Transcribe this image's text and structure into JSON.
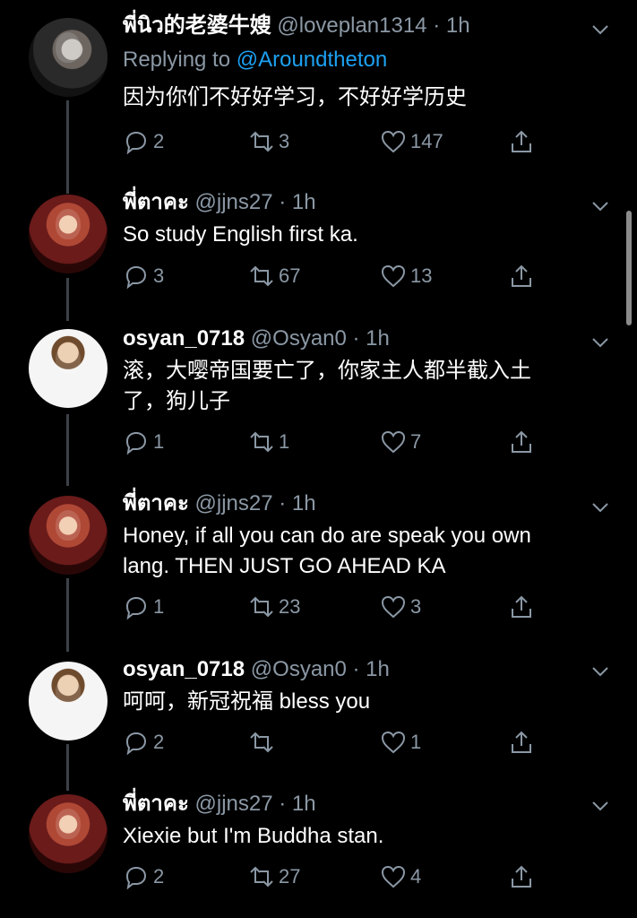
{
  "tweets": [
    {
      "name": "พี่นิว的老婆牛嫂",
      "handle": "@loveplan1314 · 1h",
      "replying_label": "Replying to ",
      "replying_to": "@Aroundtheton",
      "text_lines": [
        "因为你们不好好学习，不好好学历史"
      ],
      "replies": "2",
      "retweets": "3",
      "likes": "147"
    },
    {
      "name": "พี่ตาคะ",
      "handle": "@jjns27 · 1h",
      "text_lines": [
        "So study English first ka."
      ],
      "replies": "3",
      "retweets": "67",
      "likes": "13"
    },
    {
      "name": "osyan_0718",
      "handle": "@Osyan0 · 1h",
      "text_lines": [
        "滚，大嘤帝国要亡了，你家主人都半截入土",
        "了，狗儿子"
      ],
      "replies": "1",
      "retweets": "1",
      "likes": "7"
    },
    {
      "name": "พี่ตาคะ",
      "handle": "@jjns27 · 1h",
      "text_lines": [
        "Honey, if all you can do are speak you own",
        "lang. THEN JUST GO AHEAD KA"
      ],
      "replies": "1",
      "retweets": "23",
      "likes": "3"
    },
    {
      "name": "osyan_0718",
      "handle": "@Osyan0 · 1h",
      "text_lines": [
        "呵呵，新冠祝福 bless you"
      ],
      "replies": "2",
      "retweets": "",
      "likes": "1"
    },
    {
      "name": "พี่ตาคะ",
      "handle": "@jjns27 · 1h",
      "text_lines": [
        "Xiexie but I'm Buddha stan."
      ],
      "replies": "2",
      "retweets": "27",
      "likes": "4"
    }
  ],
  "icons": {
    "reply": "reply-icon",
    "retweet": "retweet-icon",
    "like": "like-icon",
    "share": "share-icon",
    "more": "chevron-down-icon"
  },
  "colors": {
    "background": "#000000",
    "muted": "#8b98a5",
    "mention": "#1da1f2",
    "thread_line": "#3d4148"
  }
}
